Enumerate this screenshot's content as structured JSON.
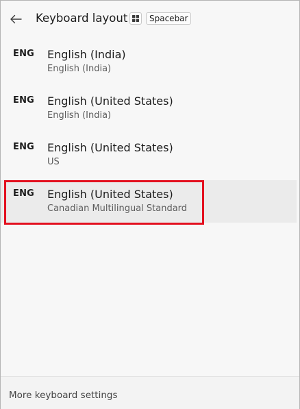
{
  "header": {
    "back_icon": "back-arrow-icon",
    "title": "Keyboard layout",
    "windows_key_icon": "windows-logo-icon",
    "spacebar_label": "Spacebar"
  },
  "layouts": [
    {
      "code": "ENG",
      "name": "English (India)",
      "detail": "English (India)",
      "selected": false
    },
    {
      "code": "ENG",
      "name": "English (United States)",
      "detail": "English (India)",
      "selected": false
    },
    {
      "code": "ENG",
      "name": "English (United States)",
      "detail": "US",
      "selected": false
    },
    {
      "code": "ENG",
      "name": "English (United States)",
      "detail": "Canadian Multilingual Standard",
      "selected": true
    }
  ],
  "footer": {
    "link_label": "More keyboard settings"
  },
  "colors": {
    "highlight": "#e3101f",
    "selected_bg": "#ebebeb",
    "panel_bg": "#f7f7f7"
  }
}
